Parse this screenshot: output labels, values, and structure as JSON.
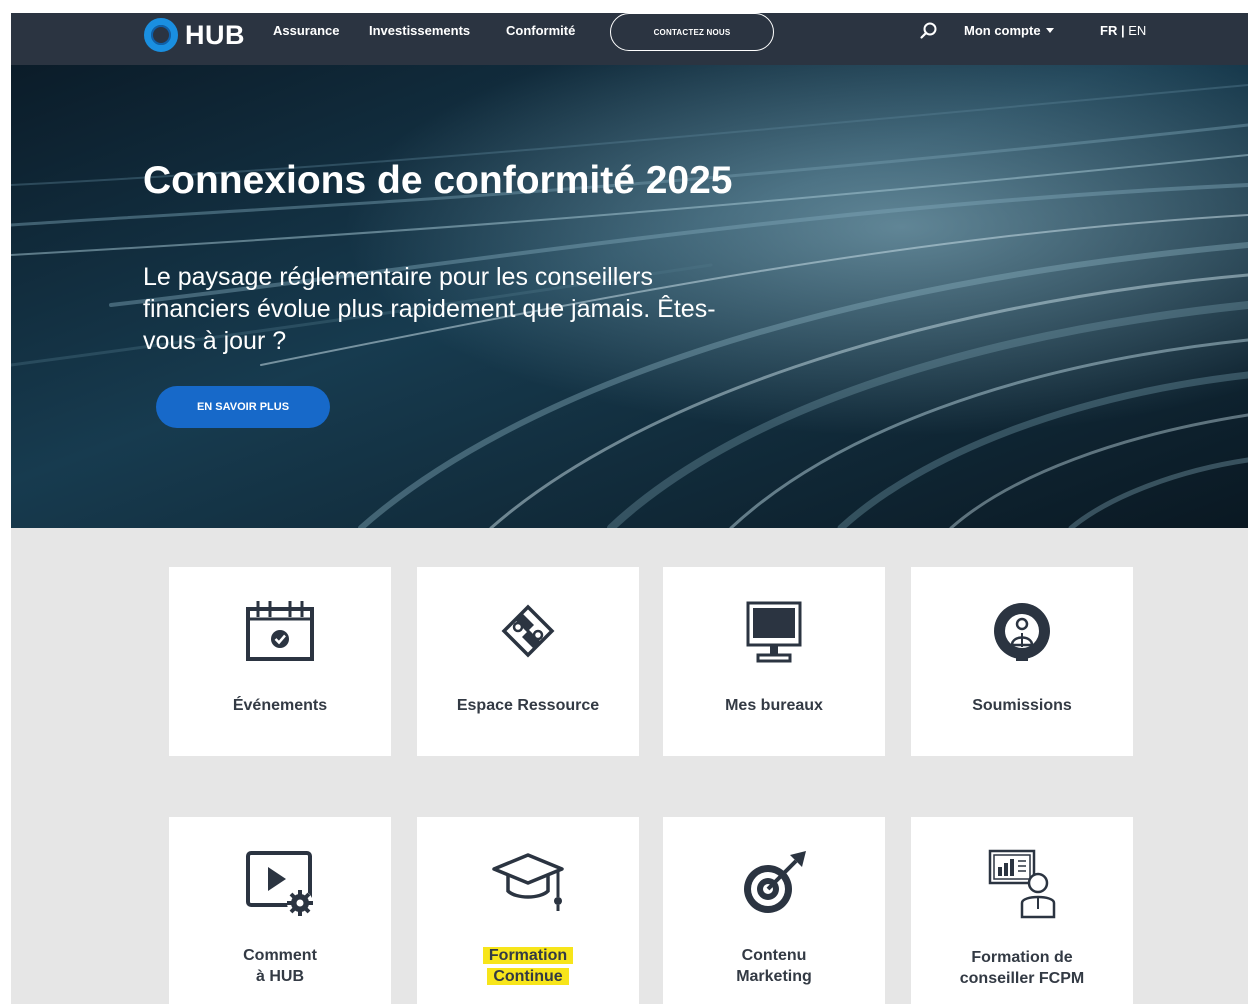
{
  "header": {
    "logo_text": "HUB",
    "nav": [
      "Assurance",
      "Investissements",
      "Conformité"
    ],
    "contact_label": "CONTACTEZ NOUS",
    "account_label": "Mon compte",
    "lang_fr": "FR",
    "lang_sep": " | ",
    "lang_en": "EN"
  },
  "hero": {
    "title": "Connexions de conformité 2025",
    "subtitle": "Le paysage réglementaire pour les conseillers financiers évolue plus rapidement que jamais. Êtes-vous à jour ?",
    "button_label": "EN SAVOIR PLUS"
  },
  "tiles": [
    {
      "icon": "calendar-check-icon",
      "line1": "Événements",
      "line2": ""
    },
    {
      "icon": "puzzle-icon",
      "line1": "Espace Ressource",
      "line2": ""
    },
    {
      "icon": "monitor-icon",
      "line1": "Mes bureaux",
      "line2": ""
    },
    {
      "icon": "person-circle-icon",
      "line1": "Soumissions",
      "line2": ""
    },
    {
      "icon": "video-settings-icon",
      "line1": "Comment",
      "line2": "à HUB"
    },
    {
      "icon": "graduation-cap-icon",
      "line1": "Formation",
      "line2": "Continue"
    },
    {
      "icon": "target-icon",
      "line1": "Contenu",
      "line2": "Marketing"
    },
    {
      "icon": "presenter-chart-icon",
      "line1": "Formation de",
      "line2": "conseiller FCPM"
    }
  ],
  "colors": {
    "header_bg": "#2b3441",
    "accent_blue": "#1769c9",
    "highlight": "#f7e51a",
    "tiles_bg": "#e6e6e6"
  }
}
